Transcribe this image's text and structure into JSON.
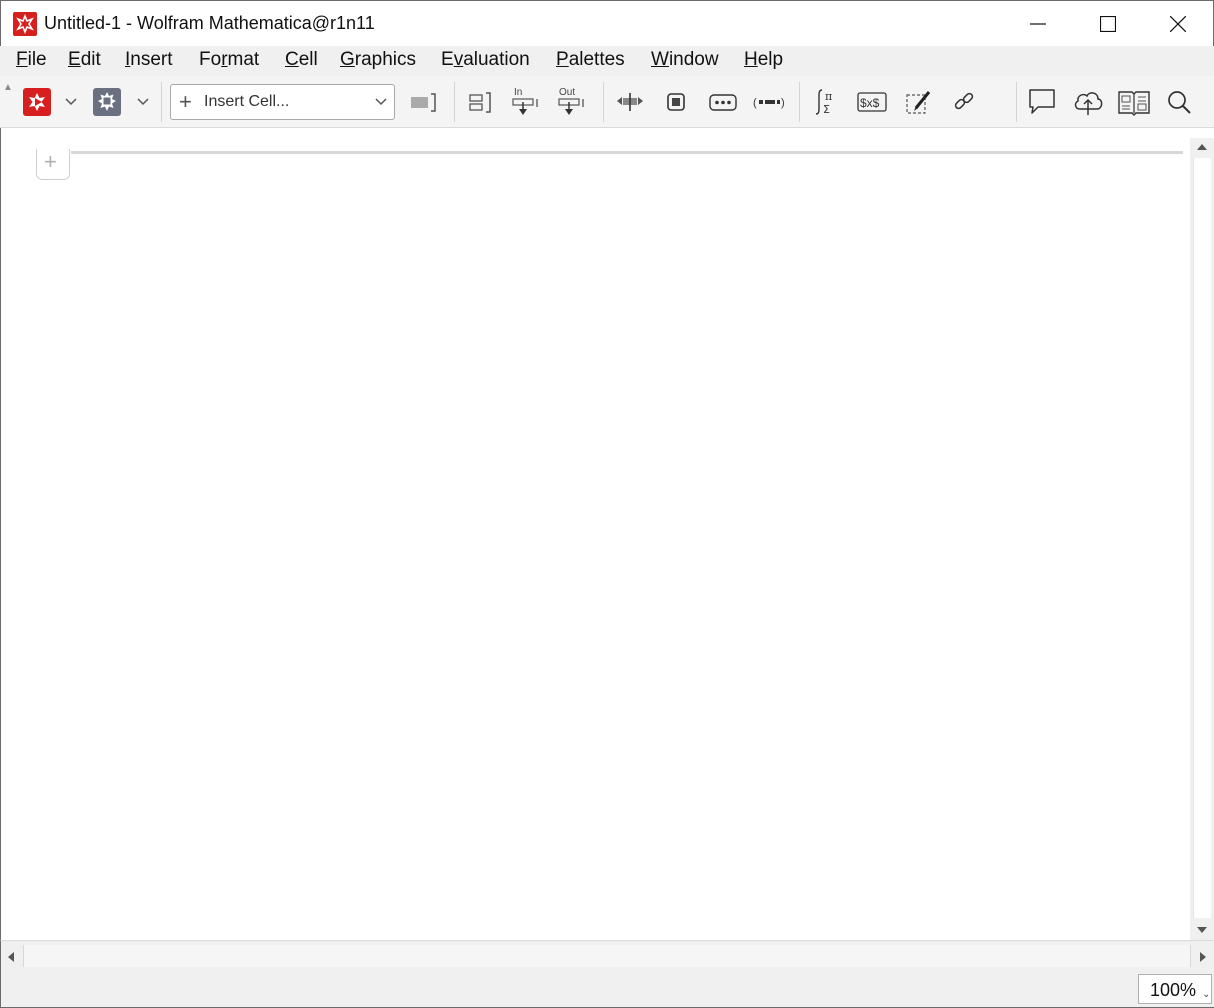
{
  "window": {
    "title": "Untitled-1 - Wolfram Mathematica@r1n11"
  },
  "menubar": {
    "items": [
      {
        "pre": "",
        "key": "F",
        "post": "ile"
      },
      {
        "pre": "",
        "key": "E",
        "post": "dit"
      },
      {
        "pre": "",
        "key": "I",
        "post": "nsert"
      },
      {
        "pre": "Fo",
        "key": "r",
        "post": "mat"
      },
      {
        "pre": "",
        "key": "C",
        "post": "ell"
      },
      {
        "pre": "",
        "key": "G",
        "post": "raphics"
      },
      {
        "pre": "E",
        "key": "v",
        "post": "aluation"
      },
      {
        "pre": "",
        "key": "P",
        "post": "alettes"
      },
      {
        "pre": "",
        "key": "W",
        "post": "indow"
      },
      {
        "pre": "",
        "key": "H",
        "post": "elp"
      }
    ]
  },
  "toolbar": {
    "insert_cell_label": "Insert Cell...",
    "in_label": "In",
    "out_label": "Out",
    "dollar_label": "$x$"
  },
  "status": {
    "zoom": "100%"
  },
  "colors": {
    "brand_red": "#d71f1f",
    "kernel_gray": "#6a7080"
  }
}
